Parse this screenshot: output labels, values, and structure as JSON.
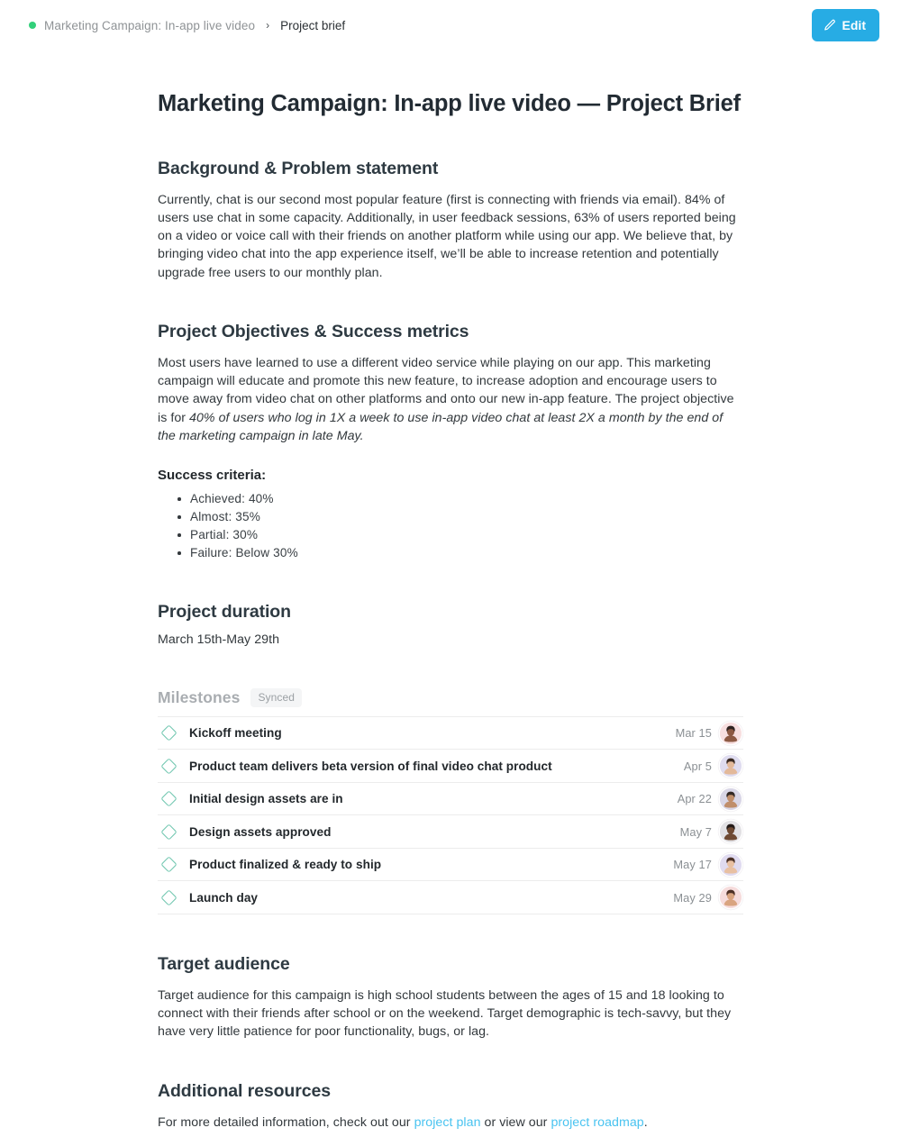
{
  "breadcrumb": {
    "status_icon": "status-dot-green",
    "status_color": "#32d07a",
    "parent": "Marketing Campaign: In-app live video",
    "separator": "›",
    "current": "Project brief"
  },
  "toolbar": {
    "edit_label": "Edit",
    "edit_icon": "pencil-icon",
    "accent_color": "#27ace4"
  },
  "document": {
    "title": "Marketing Campaign: In-app live video — Project Brief",
    "sections": {
      "background": {
        "heading": "Background & Problem statement",
        "body": "Currently, chat is our second most popular feature (first is connecting with friends via email). 84% of users use chat in some capacity. Additionally, in user feedback sessions, 63% of users reported being on a video or voice call with their friends on another platform while using our app. We believe that, by bringing video chat into the app experience itself, we’ll be able to increase retention and potentially upgrade free users to our monthly plan."
      },
      "objectives": {
        "heading": "Project Objectives & Success metrics",
        "body_plain": "Most users have learned to use a different video service while playing on our app. This marketing campaign will educate and promote this new feature, to increase adoption and encourage users to move away from video chat on other platforms and onto our new in-app feature. The project objective is for ",
        "body_italic": "40% of users who log in 1X a week to use in-app video chat at least 2X a month by the end of the marketing campaign in late May.",
        "criteria_heading": "Success criteria:",
        "criteria": [
          "Achieved: 40%",
          "Almost: 35%",
          "Partial: 30%",
          "Failure: Below 30%"
        ]
      },
      "duration": {
        "heading": "Project duration",
        "value": "March 15th-May 29th"
      },
      "milestones": {
        "heading": "Milestones",
        "badge": "Synced",
        "rows": [
          {
            "icon": "diamond-icon",
            "name": "Kickoff meeting",
            "date": "Mar 15",
            "avatar": "avatar-woman-1",
            "avatar_bg": "#f7dfe0",
            "skin": "#8d5a44",
            "hair": "#2e2320"
          },
          {
            "icon": "diamond-icon",
            "name": "Product team delivers beta version of final video chat product",
            "date": "Apr 5",
            "avatar": "avatar-woman-2",
            "avatar_bg": "#dfdcef",
            "skin": "#e3b99a",
            "hair": "#3a2a22"
          },
          {
            "icon": "diamond-icon",
            "name": "Initial design assets are in",
            "date": "Apr 22",
            "avatar": "avatar-man-1",
            "avatar_bg": "#d9d6e6",
            "skin": "#c08e6b",
            "hair": "#332824"
          },
          {
            "icon": "diamond-icon",
            "name": "Design assets approved",
            "date": "May 7",
            "avatar": "avatar-man-2",
            "avatar_bg": "#e2e1e4",
            "skin": "#6f4a33",
            "hair": "#241b18"
          },
          {
            "icon": "diamond-icon",
            "name": "Product finalized & ready to ship",
            "date": "May 17",
            "avatar": "avatar-woman-3",
            "avatar_bg": "#e0dbf0",
            "skin": "#e8c0a2",
            "hair": "#4a3026"
          },
          {
            "icon": "diamond-icon",
            "name": "Launch day",
            "date": "May 29",
            "avatar": "avatar-woman-4",
            "avatar_bg": "#f6dcdc",
            "skin": "#d9a480",
            "hair": "#4c2f25"
          }
        ]
      },
      "audience": {
        "heading": "Target audience",
        "body": "Target audience for this campaign is high school students between the ages of 15 and 18 looking to connect with their friends after school or on the weekend. Target demographic is tech-savvy, but they have very little patience for poor functionality, bugs, or lag."
      },
      "resources": {
        "heading": "Additional resources",
        "text_before": "For more detailed information, check out our ",
        "link_1": "project plan",
        "text_middle": " or view our ",
        "link_2": "project roadmap",
        "text_after": ".",
        "link_color": "#49c3f0"
      }
    }
  }
}
